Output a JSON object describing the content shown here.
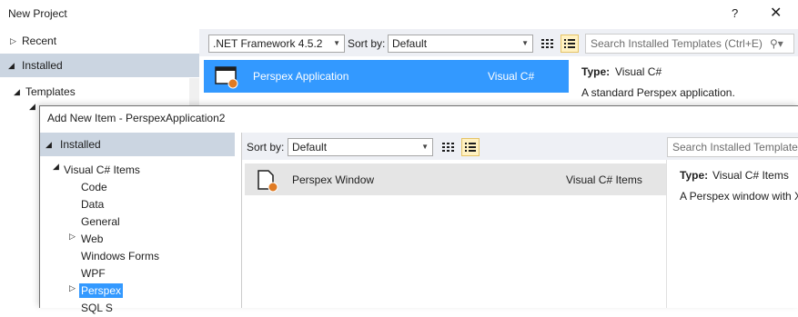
{
  "new_project": {
    "title": "New Project",
    "help_glyph": "?",
    "close_glyph": "✕",
    "tree": {
      "recent": "Recent",
      "installed": "Installed",
      "templates": "Templates"
    },
    "toolbar": {
      "framework_value": ".NET Framework 4.5.2",
      "sort_label": "Sort by:",
      "sort_value": "Default",
      "search_placeholder": "Search Installed Templates (Ctrl+E)"
    },
    "item": {
      "name": "Perspex Application",
      "language": "Visual C#"
    },
    "detail": {
      "type_label": "Type:",
      "type_value": "Visual C#",
      "description": "A standard Perspex application."
    }
  },
  "add_new_item": {
    "title": "Add New Item - PerspexApplication2",
    "tree": {
      "installed": "Installed",
      "root": "Visual C# Items",
      "children": [
        "Code",
        "Data",
        "General",
        "Web",
        "Windows Forms",
        "WPF",
        "Perspex",
        "SQL S"
      ]
    },
    "toolbar": {
      "sort_label": "Sort by:",
      "sort_value": "Default",
      "search_placeholder": "Search Installed Templates"
    },
    "item": {
      "name": "Perspex Window",
      "language": "Visual C# Items"
    },
    "detail": {
      "type_label": "Type:",
      "type_value": "Visual C# Items",
      "description": "A Perspex window with X"
    }
  },
  "colors": {
    "selection_blue": "#3399ff",
    "installed_bg": "#cbd5e1",
    "toolbar_bg": "#eef0f5",
    "badge_orange": "#e07b24"
  }
}
